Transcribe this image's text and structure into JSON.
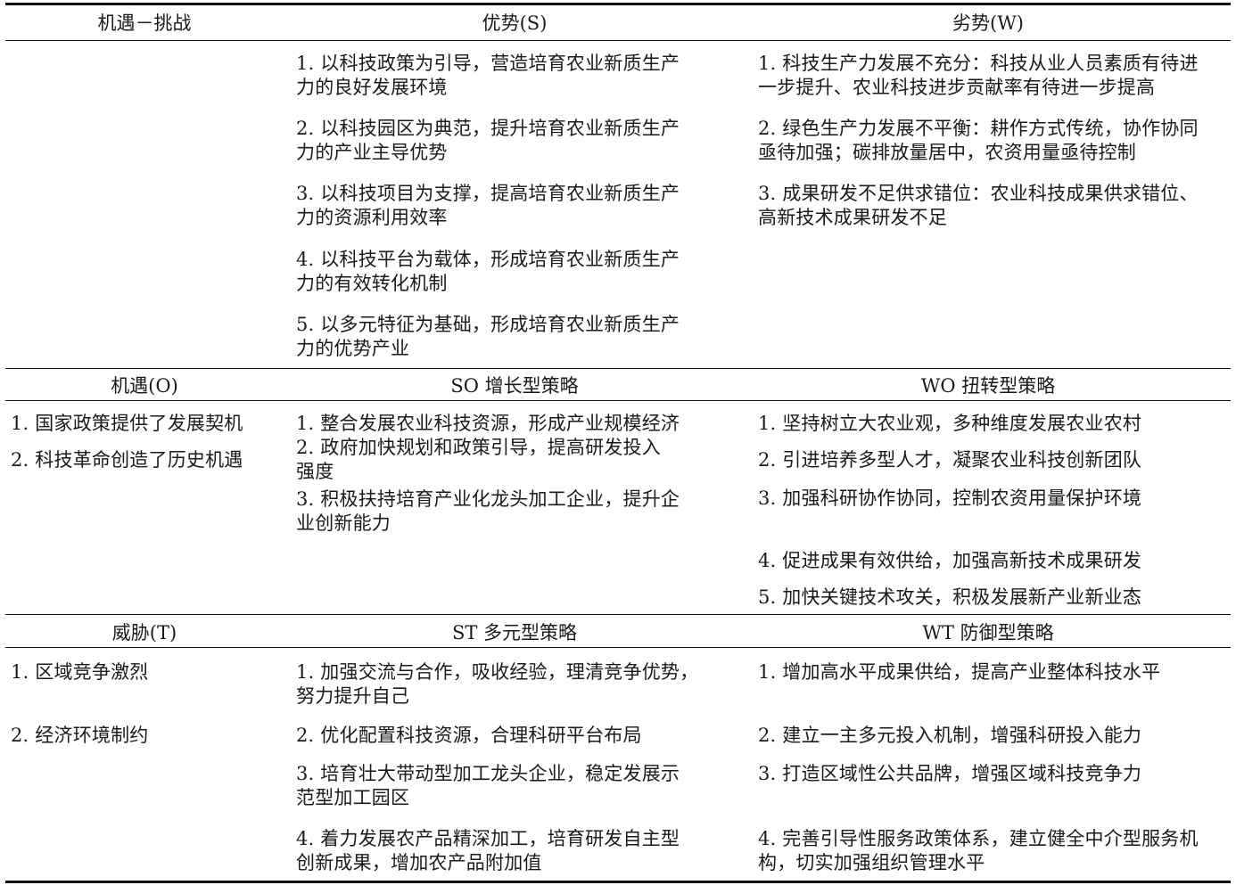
{
  "table": {
    "headers": {
      "corner": "机遇－挑战",
      "strengths": "优势(S)",
      "weaknesses": "劣势(W)",
      "opportunities": "机遇(O)",
      "so": "SO 增长型策略",
      "wo": "WO 扭转型策略",
      "threats": "威胁(T)",
      "st": "ST 多元型策略",
      "wt": "WT 防御型策略"
    },
    "strengths": [
      "1. 以科技政策为引导，营造培育农业新质生产\n力的良好发展环境",
      "2. 以科技园区为典范，提升培育农业新质生产\n力的产业主导优势",
      "3. 以科技项目为支撑，提高培育农业新质生产\n力的资源利用效率",
      "4. 以科技平台为载体，形成培育农业新质生产\n力的有效转化机制",
      "5. 以多元特征为基础，形成培育农业新质生产\n力的优势产业"
    ],
    "weaknesses": [
      "1. 科技生产力发展不充分：科技从业人员素质有待进\n一步提升、农业科技进步贡献率有待进一步提高",
      "2. 绿色生产力发展不平衡：耕作方式传统，协作协同\n亟待加强；碳排放量居中，农资用量亟待控制",
      "3. 成果研发不足供求错位：农业科技成果供求错位、\n高新技术成果研发不足"
    ],
    "opportunities": [
      "1. 国家政策提供了发展契机",
      "2. 科技革命创造了历史机遇"
    ],
    "so": [
      "1. 整合发展农业科技资源，形成产业规模经济",
      "2. 政府加快规划和政策引导，提高研发投入\n强度",
      "3. 积极扶持培育产业化龙头加工企业，提升企\n业创新能力"
    ],
    "wo": [
      "1. 坚持树立大农业观，多种维度发展农业农村",
      "2. 引进培养多型人才，凝聚农业科技创新团队",
      "3. 加强科研协作协同，控制农资用量保护环境",
      "4. 促进成果有效供给，加强高新技术成果研发",
      "5. 加快关键技术攻关，积极发展新产业新业态"
    ],
    "threats": [
      "1. 区域竞争激烈",
      "2. 经济环境制约"
    ],
    "st": [
      "1. 加强交流与合作，吸收经验，理清竞争优势，\n努力提升自己",
      "2. 优化配置科技资源，合理科研平台布局",
      "3. 培育壮大带动型加工龙头企业，稳定发展示\n范型加工园区",
      "4. 着力发展农产品精深加工，培育研发自主型\n创新成果，增加农产品附加值"
    ],
    "wt": [
      "1. 增加高水平成果供给，提高产业整体科技水平",
      "2. 建立一主多元投入机制，增强科研投入能力",
      "3. 打造区域性公共品牌，增强区域科技竞争力",
      "4. 完善引导性服务政策体系，建立健全中介型服务机\n构，切实加强组织管理水平"
    ]
  }
}
